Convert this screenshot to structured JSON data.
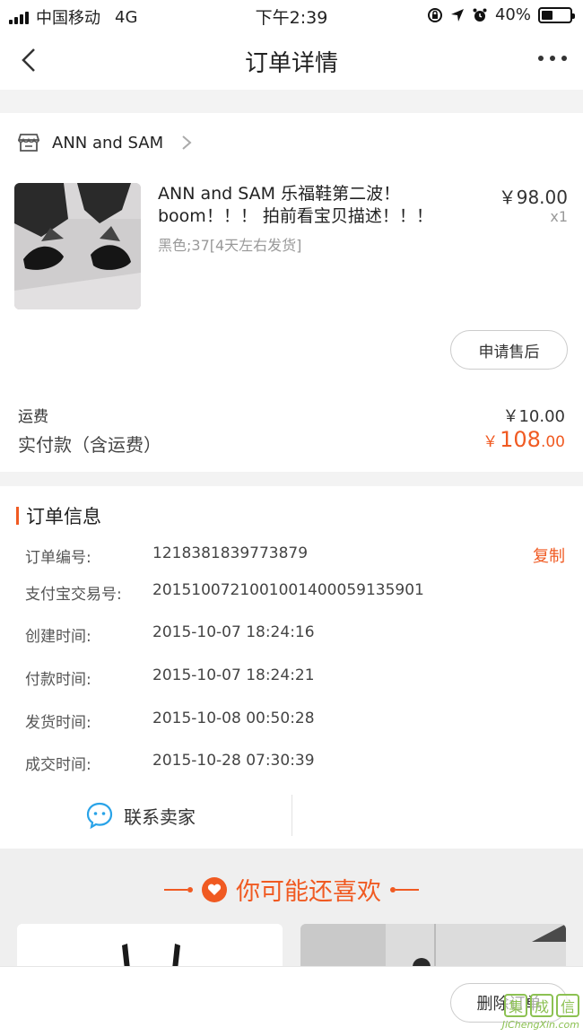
{
  "status_bar": {
    "carrier": "中国移动",
    "network": "4G",
    "time": "下午2:39",
    "battery": "40%",
    "battery_level": 0.4
  },
  "nav": {
    "title": "订单详情"
  },
  "shop": {
    "name": "ANN and SAM"
  },
  "product": {
    "title": "ANN and SAM 乐福鞋第二波！boom！！！ 拍前看宝贝描述！！！",
    "sku": "黑色;37[4天左右发货]",
    "price": "￥98.00",
    "quantity": "x1",
    "after_sale_label": "申请售后"
  },
  "summary": {
    "shipping_label": "运费",
    "shipping_value": "￥10.00",
    "paid_label": "实付款（含运费）",
    "paid_symbol": "￥",
    "paid_int": "108",
    "paid_dec": ".00"
  },
  "order_info": {
    "title": "订单信息",
    "copy_label": "复制",
    "rows": [
      {
        "key": "订单编号:",
        "value": "1218381839773879"
      },
      {
        "key": "支付宝交易号:",
        "value": "2015100721001001400059135901"
      },
      {
        "key": "创建时间:",
        "value": "2015-10-07 18:24:16"
      },
      {
        "key": "付款时间:",
        "value": "2015-10-07 18:24:21"
      },
      {
        "key": "发货时间:",
        "value": "2015-10-08 00:50:28"
      },
      {
        "key": "成交时间:",
        "value": "2015-10-28 07:30:39"
      }
    ],
    "contact_label": "联系卖家"
  },
  "recommend": {
    "title": "你可能还喜欢"
  },
  "bottom": {
    "delete_label": "删除订单"
  },
  "watermark": {
    "chars": [
      "集",
      "成",
      "信"
    ],
    "site": "JiChengXin.com"
  },
  "colors": {
    "accent": "#f05a22",
    "contact_icon": "#29a3e8",
    "watermark": "#8cc152"
  }
}
